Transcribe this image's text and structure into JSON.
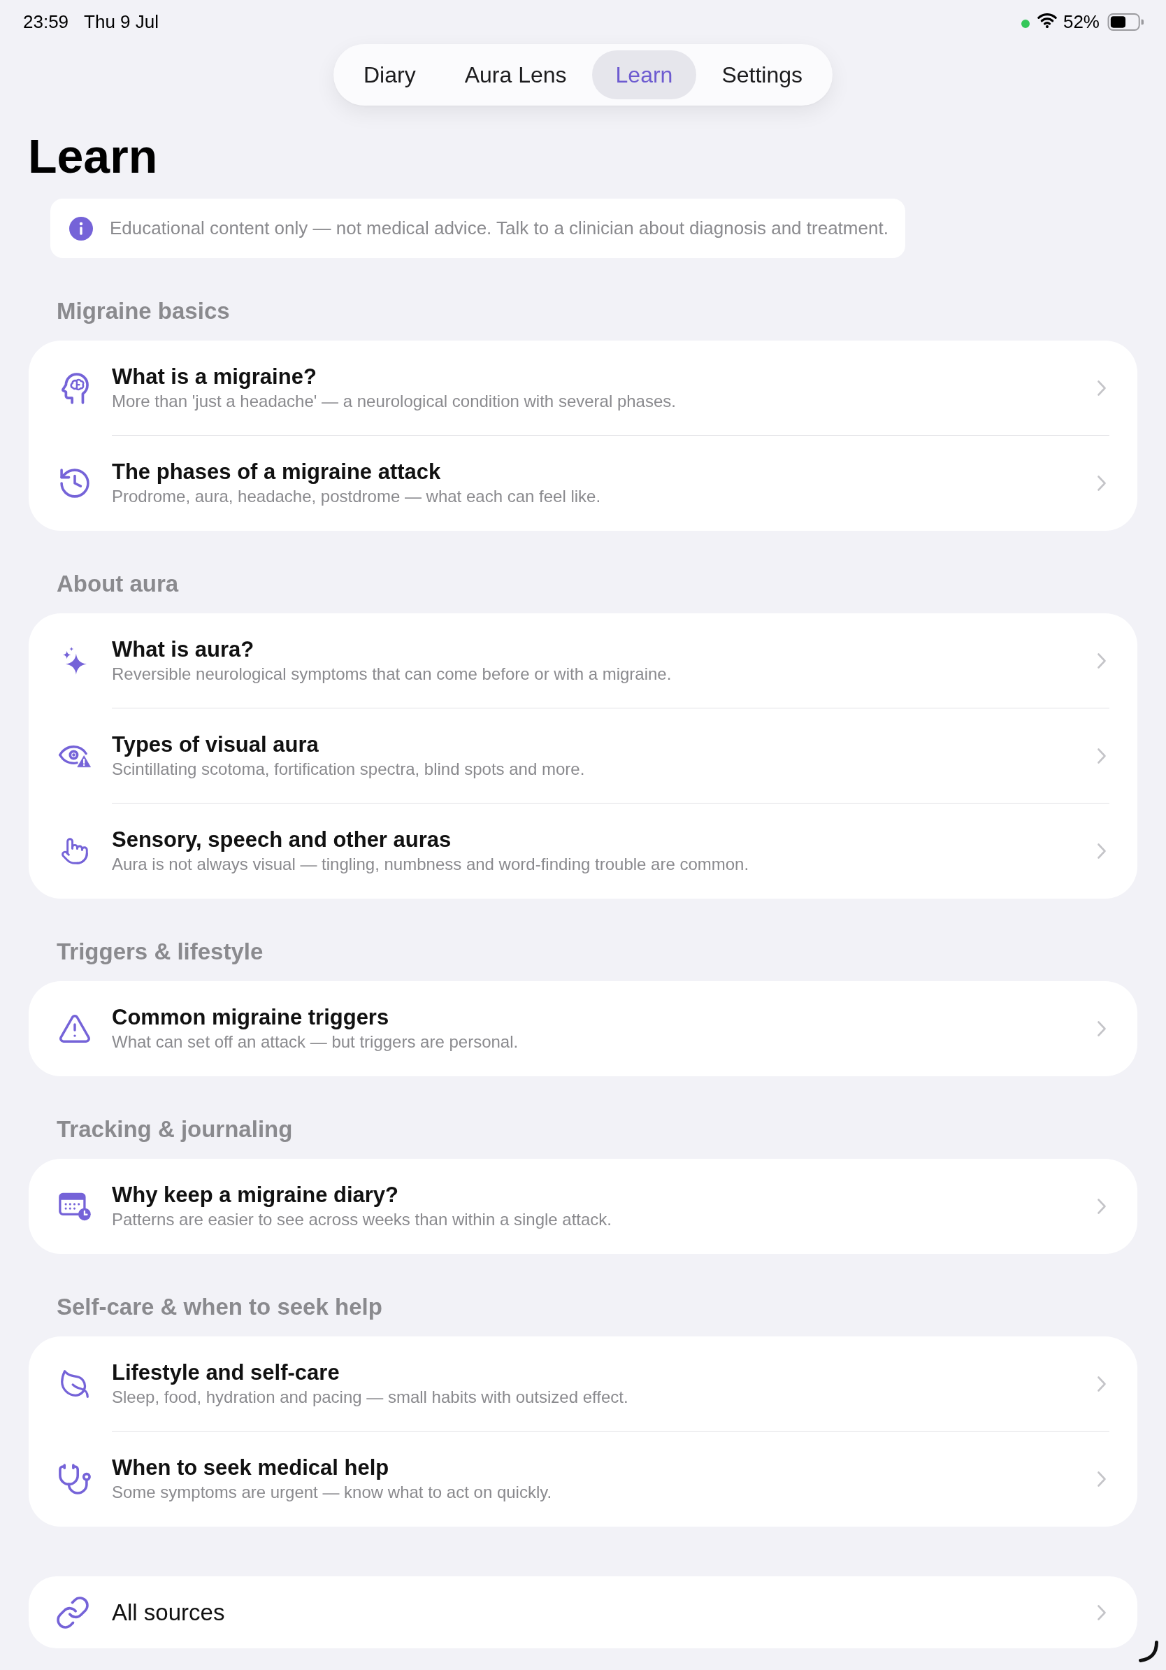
{
  "status_bar": {
    "time": "23:59",
    "date": "Thu 9 Jul",
    "battery": "52%"
  },
  "tabs": [
    {
      "label": "Diary",
      "selected": false
    },
    {
      "label": "Aura Lens",
      "selected": false
    },
    {
      "label": "Learn",
      "selected": true
    },
    {
      "label": "Settings",
      "selected": false
    }
  ],
  "title": "Learn",
  "notice": "Educational content only — not medical advice. Talk to a clinician about diagnosis and treatment.",
  "sections": [
    {
      "title": "Migraine basics",
      "items": [
        {
          "title": "What is a migraine?",
          "subtitle": "More than 'just a headache' — a neurological condition with several phases."
        },
        {
          "title": "The phases of a migraine attack",
          "subtitle": "Prodrome, aura, headache, postdrome — what each can feel like."
        }
      ]
    },
    {
      "title": "About aura",
      "items": [
        {
          "title": "What is aura?",
          "subtitle": "Reversible neurological symptoms that can come before or with a migraine."
        },
        {
          "title": "Types of visual aura",
          "subtitle": "Scintillating scotoma, fortification spectra, blind spots and more."
        },
        {
          "title": "Sensory, speech and other auras",
          "subtitle": "Aura is not always visual — tingling, numbness and word-finding trouble are common."
        }
      ]
    },
    {
      "title": "Triggers & lifestyle",
      "items": [
        {
          "title": "Common migraine triggers",
          "subtitle": "What can set off an attack — but triggers are personal."
        }
      ]
    },
    {
      "title": "Tracking & journaling",
      "items": [
        {
          "title": "Why keep a migraine diary?",
          "subtitle": "Patterns are easier to see across weeks than within a single attack."
        }
      ]
    },
    {
      "title": "Self-care & when to seek help",
      "items": [
        {
          "title": "Lifestyle and self-care",
          "subtitle": "Sleep, food, hydration and pacing — small habits with outsized effect."
        },
        {
          "title": "When to seek medical help",
          "subtitle": "Some symptoms are urgent — know what to act on quickly."
        }
      ]
    }
  ],
  "sources_link": {
    "label": "All sources"
  }
}
